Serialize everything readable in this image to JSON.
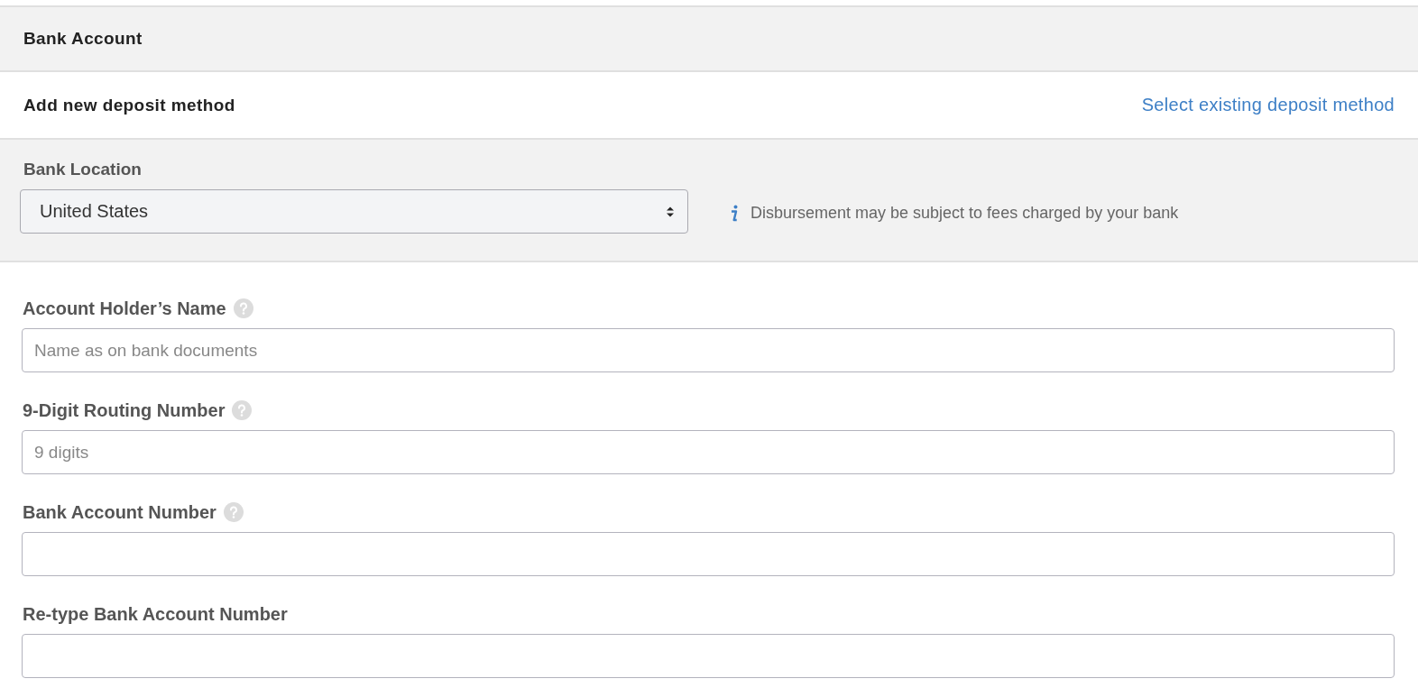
{
  "section_title": "Bank Account",
  "deposit": {
    "title": "Add new deposit method",
    "link": "Select existing deposit method"
  },
  "bank_location": {
    "label": "Bank Location",
    "value": "United States",
    "info": "Disbursement may be subject to fees charged by your bank"
  },
  "fields": [
    {
      "label": "Account Holder’s Name",
      "help": true,
      "placeholder": "Name as on bank documents"
    },
    {
      "label": "9-Digit Routing Number",
      "help": true,
      "placeholder": "9 digits"
    },
    {
      "label": "Bank Account Number",
      "help": true
    },
    {
      "label": "Re-type Bank Account Number",
      "help": false
    }
  ]
}
